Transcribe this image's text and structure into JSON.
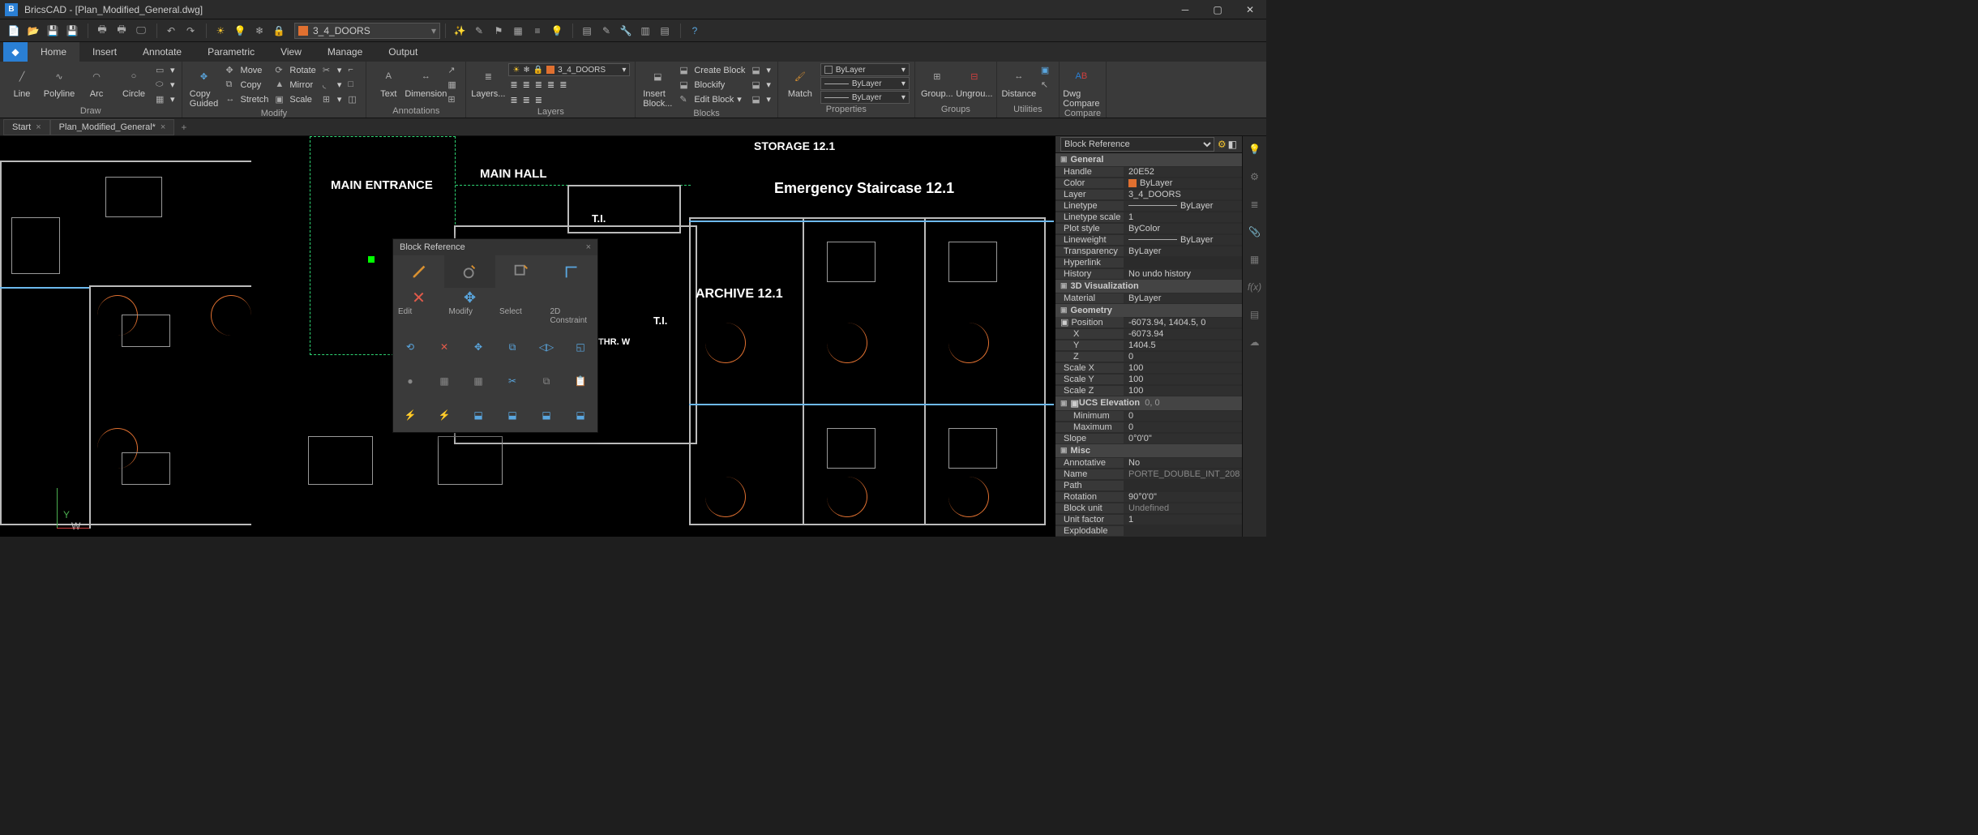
{
  "app": {
    "title": "BricsCAD - [Plan_Modified_General.dwg]"
  },
  "quickbar": {
    "layer_name": "3_4_DOORS"
  },
  "ribbon": {
    "tabs": [
      "Home",
      "Insert",
      "Annotate",
      "Parametric",
      "View",
      "Manage",
      "Output"
    ],
    "groups": {
      "draw": {
        "label": "Draw",
        "line": "Line",
        "polyline": "Polyline",
        "arc": "Arc",
        "circle": "Circle"
      },
      "modify": {
        "label": "Modify",
        "copy_guided": "Copy\nGuided",
        "move": "Move",
        "copy": "Copy",
        "stretch": "Stretch",
        "rotate": "Rotate",
        "mirror": "Mirror",
        "scale": "Scale"
      },
      "annotations": {
        "label": "Annotations",
        "text": "Text",
        "dimension": "Dimension"
      },
      "layers": {
        "label": "Layers",
        "layers": "Layers...",
        "layer_name": "3_4_DOORS"
      },
      "blocks": {
        "label": "Blocks",
        "insert": "Insert\nBlock...",
        "create": "Create Block",
        "blockify": "Blockify",
        "edit": "Edit Block"
      },
      "match": {
        "match": "Match"
      },
      "properties": {
        "label": "Properties",
        "bylayer": "ByLayer"
      },
      "groups": {
        "label": "Groups",
        "group": "Group...",
        "ungroup": "Ungrou..."
      },
      "utilities": {
        "label": "Utilities",
        "distance": "Distance"
      },
      "compare": {
        "label": "Compare",
        "dwg": "Dwg\nCompare"
      }
    }
  },
  "doctabs": {
    "start": "Start",
    "file": "Plan_Modified_General*"
  },
  "canvas": {
    "labels": {
      "main_entrance": "MAIN ENTRANCE",
      "main_hall": "MAIN HALL",
      "storage": "STORAGE 12.1",
      "emergency": "Emergency Staircase 12.1",
      "ti1": "T.I.",
      "ti2": "T.I.",
      "archive": "ARCHIVE 12.1",
      "thr": "THR. W",
      "y": "Y",
      "w": "W"
    }
  },
  "quad": {
    "title": "Block Reference",
    "tabs": {
      "edit": "Edit",
      "modify": "Modify",
      "select": "Select",
      "constraint": "2D Constraint"
    }
  },
  "props": {
    "selector": "Block Reference",
    "sections": {
      "general": "General",
      "viz3d": "3D Visualization",
      "geometry": "Geometry",
      "ucs": "UCS Elevation",
      "misc": "Misc"
    },
    "general": {
      "handle_k": "Handle",
      "handle_v": "20E52",
      "color_k": "Color",
      "color_v": "ByLayer",
      "layer_k": "Layer",
      "layer_v": "3_4_DOORS",
      "linetype_k": "Linetype",
      "linetype_v": "ByLayer",
      "lscale_k": "Linetype scale",
      "lscale_v": "1",
      "plot_k": "Plot style",
      "plot_v": "ByColor",
      "lweight_k": "Lineweight",
      "lweight_v": "ByLayer",
      "transp_k": "Transparency",
      "transp_v": "ByLayer",
      "hyper_k": "Hyperlink",
      "hyper_v": "",
      "hist_k": "History",
      "hist_v": "No undo history"
    },
    "viz3d": {
      "material_k": "Material",
      "material_v": "ByLayer"
    },
    "geometry": {
      "pos_k": "Position",
      "pos_v": "-6073.94, 1404.5, 0",
      "x_k": "X",
      "x_v": "-6073.94",
      "y_k": "Y",
      "y_v": "1404.5",
      "z_k": "Z",
      "z_v": "0",
      "sx_k": "Scale X",
      "sx_v": "100",
      "sy_k": "Scale Y",
      "sy_v": "100",
      "sz_k": "Scale Z",
      "sz_v": "100"
    },
    "ucs": {
      "range_v": "0, 0",
      "min_k": "Minimum",
      "min_v": "0",
      "max_k": "Maximum",
      "max_v": "0",
      "slope_k": "Slope",
      "slope_v": "0°0'0\""
    },
    "misc": {
      "anno_k": "Annotative",
      "anno_v": "No",
      "name_k": "Name",
      "name_v": "PORTE_DOUBLE_INT_208",
      "path_k": "Path",
      "path_v": "",
      "rot_k": "Rotation",
      "rot_v": "90°0'0\"",
      "unit_k": "Block unit",
      "unit_v": "Undefined",
      "factor_k": "Unit factor",
      "factor_v": "1",
      "expl_k": "Explodable"
    }
  }
}
